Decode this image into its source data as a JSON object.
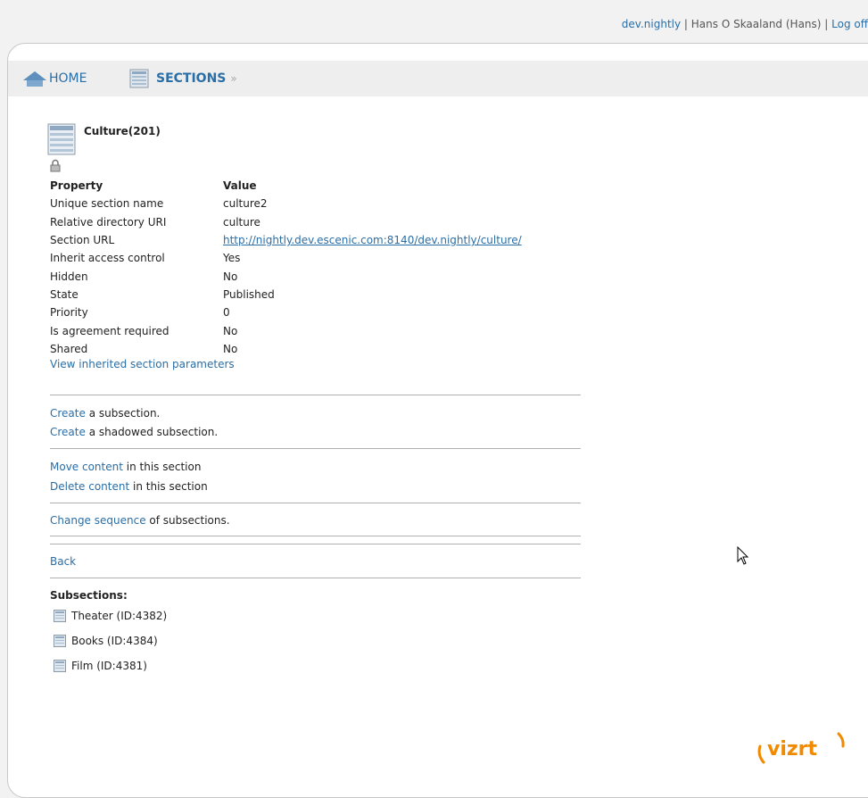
{
  "topbar": {
    "publication": "dev.nightly",
    "sep1": " | ",
    "user": "Hans O Skaaland (Hans)",
    "sep2": " | ",
    "logout": "Log off"
  },
  "nav": {
    "home": "HOME",
    "sections": "SECTIONS",
    "separator": "»"
  },
  "section": {
    "title": "Culture(201)",
    "headers": {
      "property": "Property",
      "value": "Value"
    },
    "rows": [
      {
        "property": "Unique section name",
        "value": "culture2"
      },
      {
        "property": "Relative directory URI",
        "value": "culture"
      },
      {
        "property": "Section URL",
        "value": "http://nightly.dev.escenic.com:8140/dev.nightly/culture/"
      },
      {
        "property": "Inherit access control",
        "value": "Yes"
      },
      {
        "property": "Hidden",
        "value": "No"
      },
      {
        "property": "State",
        "value": "Published"
      },
      {
        "property": "Priority",
        "value": "0"
      },
      {
        "property": "Is agreement required",
        "value": "No"
      },
      {
        "property": "Shared",
        "value": "No"
      }
    ],
    "inherited_link": "View inherited section parameters"
  },
  "actions": {
    "create_sub_link": "Create",
    "create_sub_text": " a subsection.",
    "create_shadow_link": "Create",
    "create_shadow_text": " a shadowed subsection.",
    "move_link": "Move content",
    "move_text": " in this section",
    "delete_link": "Delete content",
    "delete_text": " in this section",
    "sequence_link": "Change sequence",
    "sequence_text": " of subsections.",
    "back": "Back"
  },
  "subsections": {
    "title": "Subsections:",
    "items": [
      {
        "label": "Theater (ID:4382)"
      },
      {
        "label": "Books (ID:4384)"
      },
      {
        "label": "Film (ID:4381)"
      }
    ]
  },
  "brand": {
    "logo_text": "vizrt",
    "accent": "#f08a00"
  },
  "colors": {
    "link": "#2a6ea6",
    "navbar": "#eeeeee",
    "rule": "#b0b0b0"
  },
  "icons": [
    "home-icon",
    "sections-icon",
    "section-icon",
    "lock-icon",
    "subsection-icon",
    "mouse-cursor-icon"
  ]
}
